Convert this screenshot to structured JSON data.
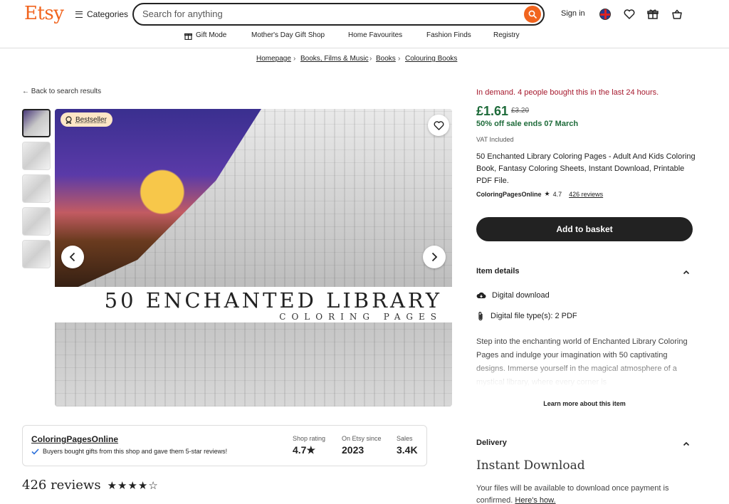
{
  "header": {
    "logo": "Etsy",
    "categories_label": "Categories",
    "search_placeholder": "Search for anything",
    "signin_label": "Sign in"
  },
  "nav": {
    "items": [
      "Gift Mode",
      "Mother's Day Gift Shop",
      "Home Favourites",
      "Fashion Finds",
      "Registry"
    ]
  },
  "breadcrumbs": [
    "Homepage",
    "Books, Films & Music",
    "Books",
    "Colouring Books"
  ],
  "back_link": "Back to search results",
  "gallery": {
    "badge": "Bestseller",
    "image_title": "50 ENCHANTED LIBRARY",
    "image_subtitle": "COLORING PAGES"
  },
  "shop_card": {
    "name": "ColoringPagesOnline",
    "note": "Buyers bought gifts from this shop and gave them 5-star reviews!",
    "stats": [
      {
        "label": "Shop rating",
        "value": "4.7★"
      },
      {
        "label": "On Etsy since",
        "value": "2023"
      },
      {
        "label": "Sales",
        "value": "3.4K"
      }
    ]
  },
  "reviews": {
    "heading": "426 reviews",
    "stars_display": "★★★★☆"
  },
  "product": {
    "demand": "In demand. 4 people bought this in the last 24 hours.",
    "price": "£1.61",
    "old_price": "£3.20",
    "sale": "50% off sale ends 07 March",
    "vat": "VAT Included",
    "title": "50 Enchanted Library Coloring Pages - Adult And Kids Coloring Book, Fantasy Coloring Sheets, Instant Download, Printable PDF File.",
    "seller": "ColoringPagesOnline",
    "rating": "4.7",
    "reviews_link": "426 reviews",
    "basket_label": "Add to basket"
  },
  "item_details": {
    "heading": "Item details",
    "rows": [
      "Digital download",
      "Digital file type(s): 2 PDF"
    ],
    "description": "Step into the enchanting world of Enchanted Library Coloring Pages and indulge your imagination with 50 captivating designs. Immerse yourself in the magical atmosphere of a mystical library, where every corner is",
    "learn_more": "Learn more about this item"
  },
  "delivery": {
    "heading": "Delivery",
    "type": "Instant Download",
    "text": "Your files will be available to download once payment is confirmed.",
    "link": "Here's how."
  },
  "colors": {
    "brand": "#f1641e",
    "sale_green": "#1e6b3a",
    "demand_red": "#a61a2e"
  }
}
